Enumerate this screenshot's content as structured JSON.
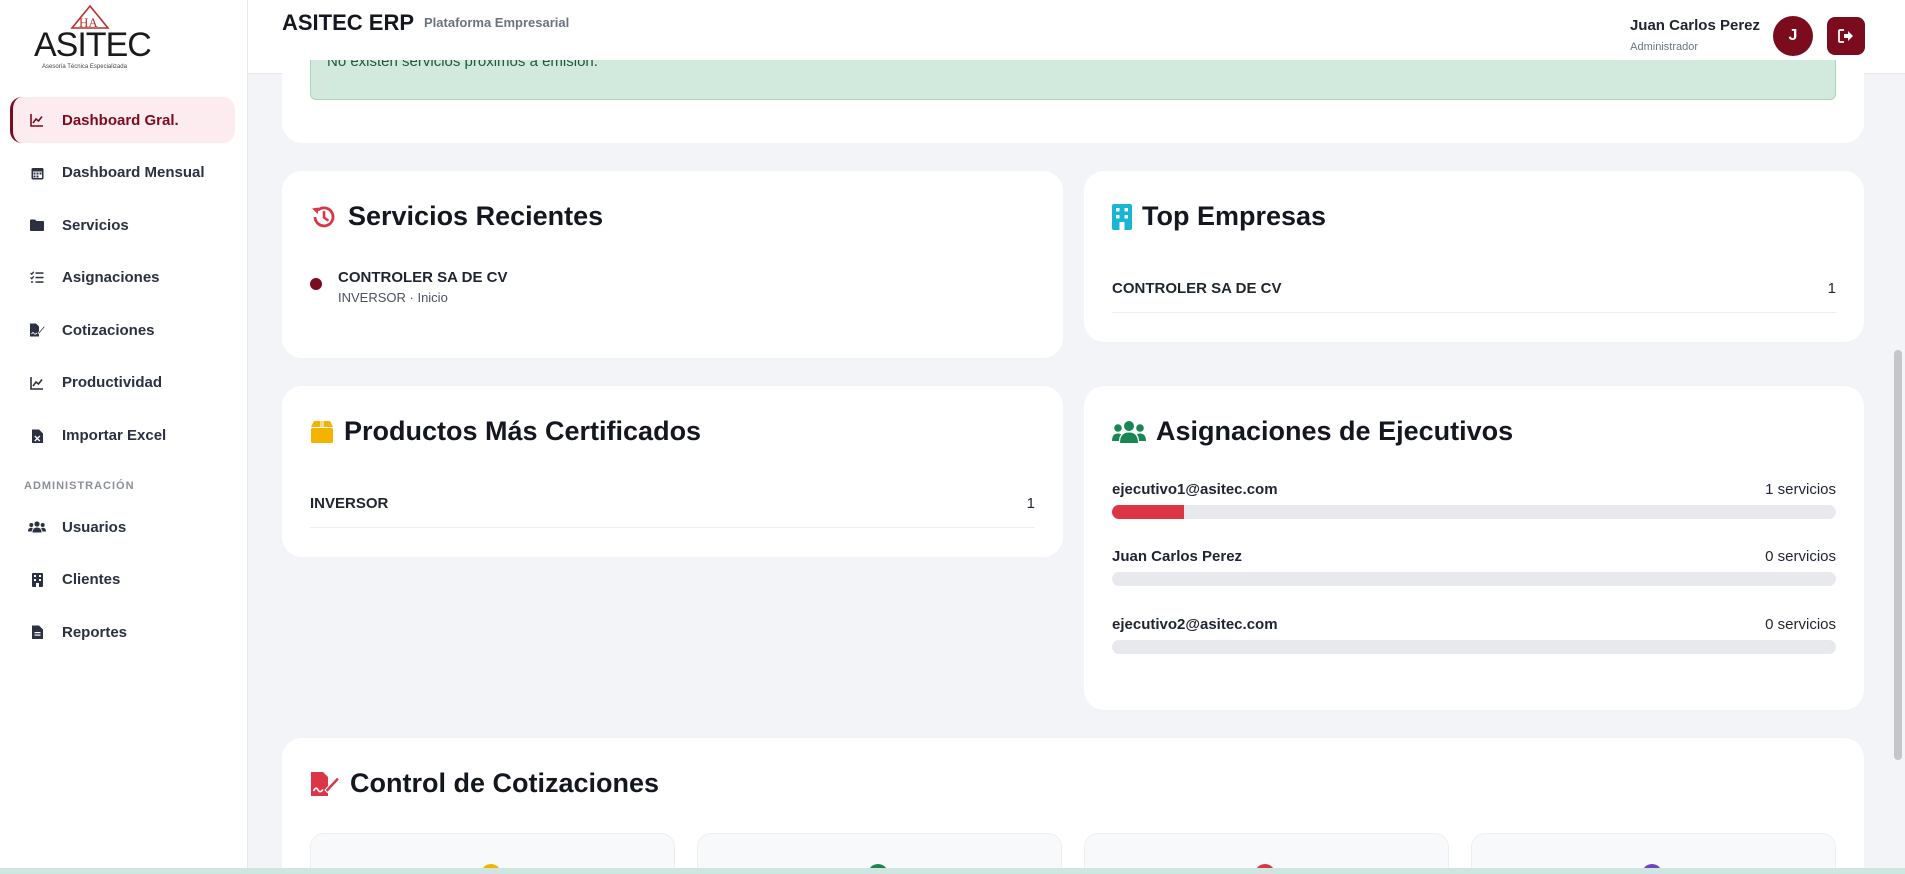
{
  "logo": {
    "brand": "ASITEC",
    "tagline": "Asesoría Técnica Especializada",
    "mark": "HA"
  },
  "header": {
    "app_title": "ASITEC ERP",
    "app_subtitle": "Plataforma Empresarial",
    "user_name": "Juan Carlos Perez",
    "user_role": "Administrador",
    "avatar_initial": "J"
  },
  "sidebar": {
    "items": [
      {
        "label": "Dashboard Gral.",
        "icon": "chart-line-icon"
      },
      {
        "label": "Dashboard Mensual",
        "icon": "calendar-icon"
      },
      {
        "label": "Servicios",
        "icon": "folder-icon"
      },
      {
        "label": "Asignaciones",
        "icon": "list-check-icon"
      },
      {
        "label": "Cotizaciones",
        "icon": "file-signature-icon"
      },
      {
        "label": "Productividad",
        "icon": "chart-line-icon"
      },
      {
        "label": "Importar Excel",
        "icon": "file-excel-icon"
      }
    ],
    "section_label": "ADMINISTRACIÓN",
    "admin_items": [
      {
        "label": "Usuarios",
        "icon": "users-icon"
      },
      {
        "label": "Clientes",
        "icon": "building-icon"
      },
      {
        "label": "Reportes",
        "icon": "file-icon"
      }
    ]
  },
  "alert": {
    "text": "No existen servicios próximos a emisión."
  },
  "servicios_recientes": {
    "title": "Servicios Recientes",
    "items": [
      {
        "name": "CONTROLER SA DE CV",
        "detail": "INVERSOR · Inicio"
      }
    ]
  },
  "top_empresas": {
    "title": "Top Empresas",
    "rows": [
      {
        "name": "CONTROLER SA DE CV",
        "value": "1"
      }
    ]
  },
  "productos": {
    "title": "Productos Más Certificados",
    "rows": [
      {
        "name": "INVERSOR",
        "value": "1"
      }
    ]
  },
  "asignaciones": {
    "title": "Asignaciones de Ejecutivos",
    "rows": [
      {
        "name": "ejecutivo1@asitec.com",
        "value": "1 servicios",
        "fraction": 0.1
      },
      {
        "name": "Juan Carlos Perez",
        "value": "0 servicios",
        "fraction": 0
      },
      {
        "name": "ejecutivo2@asitec.com",
        "value": "0 servicios",
        "fraction": 0
      }
    ]
  },
  "cotizaciones": {
    "title": "Control de Cotizaciones"
  },
  "colors": {
    "primary": "#7a0c1e",
    "danger": "#dc3545",
    "success_bg": "#d2eadd"
  }
}
